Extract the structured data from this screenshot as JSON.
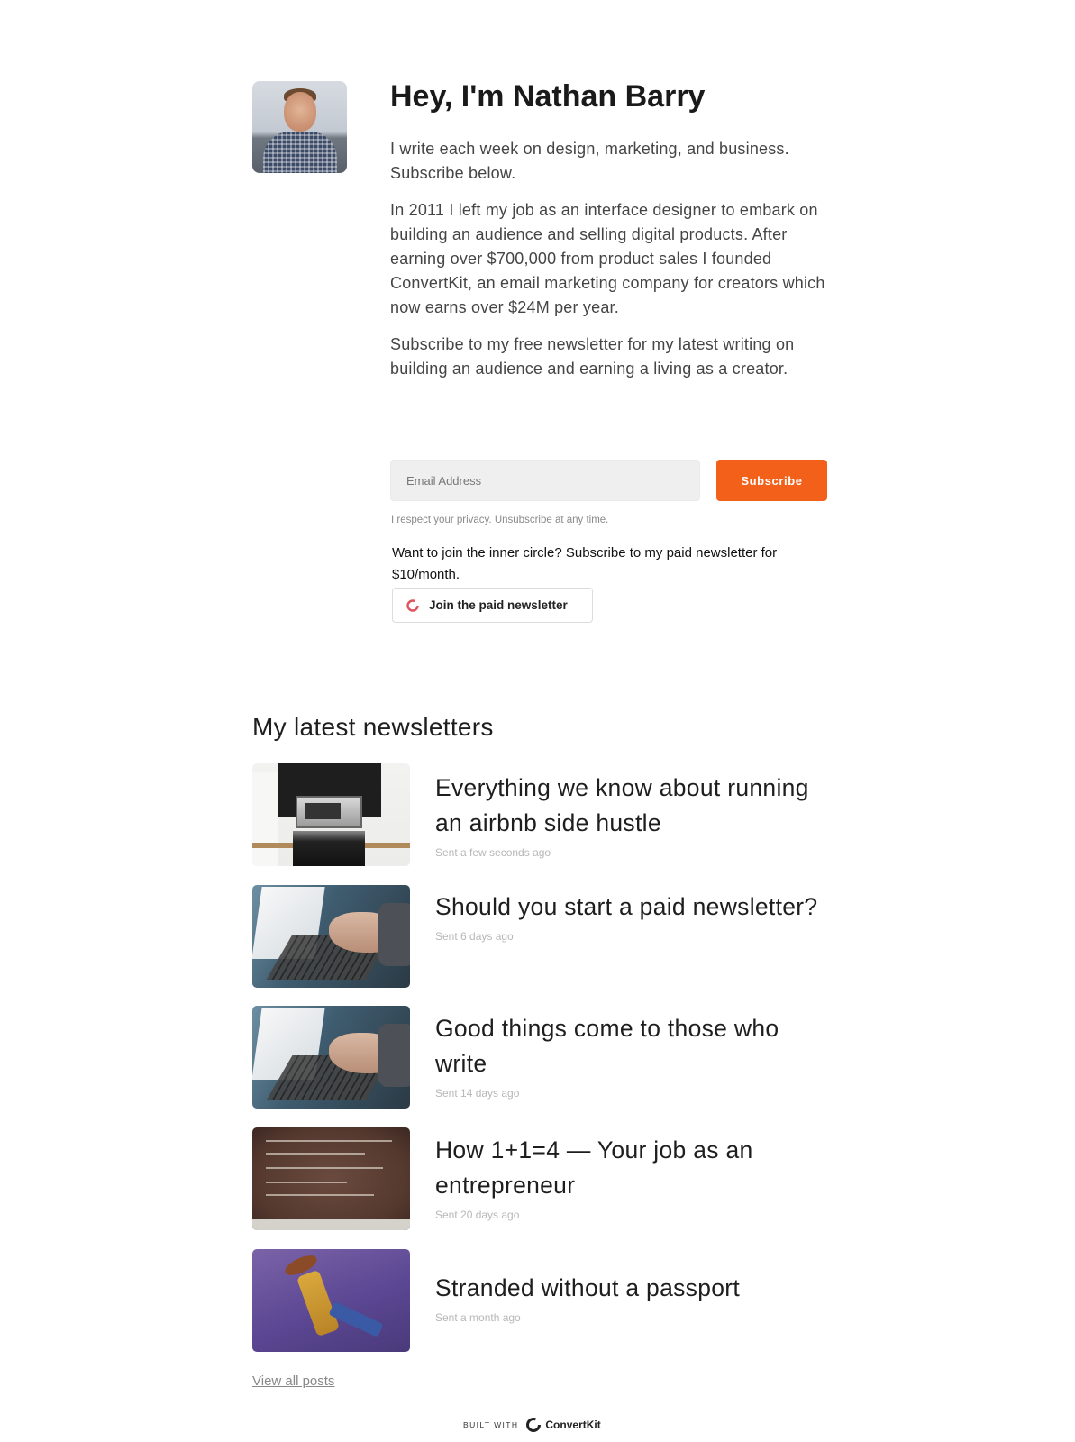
{
  "hero": {
    "title": "Hey, I'm Nathan Barry",
    "intro": "I write each week on design, marketing, and business. Subscribe below.",
    "story": "In 2011 I left my job as an interface designer to embark on building an audience and selling digital products. After earning over $700,000 from product sales I founded ConvertKit, an email marketing company for creators which now earns over $24M per year.",
    "cta": "Subscribe to my free newsletter for my latest writing on building an audience and earning a living as a creator."
  },
  "form": {
    "email_placeholder": "Email Address",
    "subscribe_label": "Subscribe",
    "privacy": "I respect your privacy. Unsubscribe at any time."
  },
  "paid": {
    "text": "Want to join the inner circle? Subscribe to my paid newsletter for $10/month.",
    "button_label": "Join the paid newsletter"
  },
  "newsletters": {
    "section_title": "My latest newsletters",
    "posts": [
      {
        "title": "Everything we know about running an airbnb side hustle",
        "date": "Sent a few seconds ago",
        "image": "kitchen-photo"
      },
      {
        "title": "Should you start a paid newsletter?",
        "date": "Sent 6 days ago",
        "image": "laptop-typing-photo"
      },
      {
        "title": "Good things come to those who write",
        "date": "Sent 14 days ago",
        "image": "laptop-typing-photo"
      },
      {
        "title": "How 1+1=4 — Your job as an entrepreneur",
        "date": "Sent 20 days ago",
        "image": "chalkboard-photo"
      },
      {
        "title": "Stranded without a passport",
        "date": "Sent a month ago",
        "image": "toy-cowboy-photo"
      }
    ],
    "view_all": "View all posts"
  },
  "footer": {
    "built_with": "BUILT WITH",
    "brand": "ConvertKit"
  },
  "colors": {
    "accent": "#f26019",
    "paid_icon": "#e0525e"
  }
}
